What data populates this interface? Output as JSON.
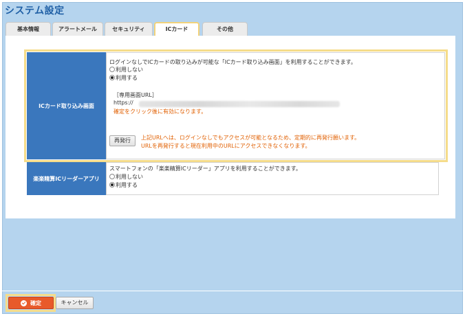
{
  "page_title": "システム設定",
  "tabs": [
    {
      "label": "基本情報",
      "active": false
    },
    {
      "label": "アラートメール",
      "active": false
    },
    {
      "label": "セキュリティ",
      "active": false
    },
    {
      "label": "ICカード",
      "active": true
    },
    {
      "label": "その他",
      "active": false
    }
  ],
  "ic_capture": {
    "label": "ICカード取り込み画面",
    "description": "ログインなしでICカードの取り込みが可能な「ICカード取り込み画面」を利用することができます。",
    "option_off": "利用しない",
    "option_on": "利用する",
    "selected": "利用する",
    "url_heading": "［専用画面URL］",
    "url_prefix": "https://",
    "url_note": "確定をクリック後に有効になります。",
    "reissue_label": "再発行",
    "warning_1": "上記URLへは、ログインなしでもアクセスが可能となるため、定期的に再発行願います。",
    "warning_2": "URLを再発行すると現在利用中のURLにアクセスできなくなります。"
  },
  "reader_app": {
    "label": "楽楽精算ICリーダーアプリ",
    "description": "スマートフォンの「楽楽精算ICリーダー」アプリを利用することができます。",
    "option_off": "利用しない",
    "option_on": "利用する",
    "selected": "利用する"
  },
  "footer": {
    "confirm_label": "確定",
    "cancel_label": "キャンセル"
  },
  "colors": {
    "accent": "#3a77bd",
    "highlight": "#f5dc8a",
    "confirm": "#e85a2a",
    "warning_text": "#e15f00",
    "background": "#b5d4ee"
  }
}
